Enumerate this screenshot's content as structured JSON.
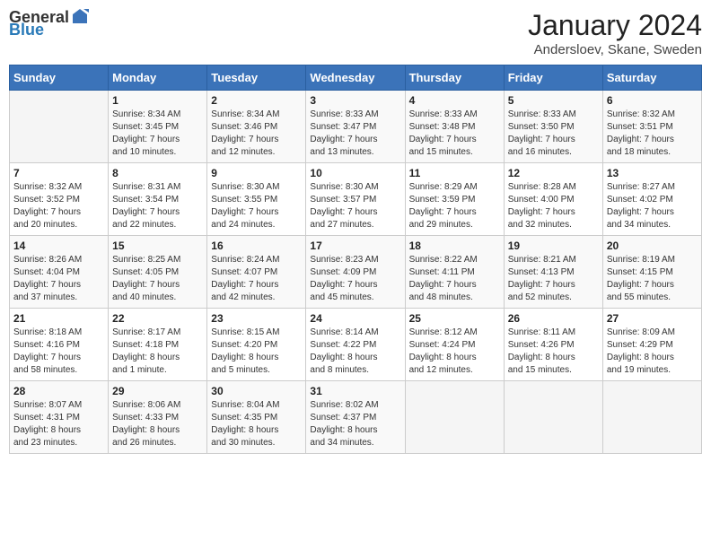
{
  "header": {
    "logo_general": "General",
    "logo_blue": "Blue",
    "month": "January 2024",
    "location": "Andersloev, Skane, Sweden"
  },
  "weekdays": [
    "Sunday",
    "Monday",
    "Tuesday",
    "Wednesday",
    "Thursday",
    "Friday",
    "Saturday"
  ],
  "weeks": [
    [
      {
        "day": "",
        "info": ""
      },
      {
        "day": "1",
        "info": "Sunrise: 8:34 AM\nSunset: 3:45 PM\nDaylight: 7 hours\nand 10 minutes."
      },
      {
        "day": "2",
        "info": "Sunrise: 8:34 AM\nSunset: 3:46 PM\nDaylight: 7 hours\nand 12 minutes."
      },
      {
        "day": "3",
        "info": "Sunrise: 8:33 AM\nSunset: 3:47 PM\nDaylight: 7 hours\nand 13 minutes."
      },
      {
        "day": "4",
        "info": "Sunrise: 8:33 AM\nSunset: 3:48 PM\nDaylight: 7 hours\nand 15 minutes."
      },
      {
        "day": "5",
        "info": "Sunrise: 8:33 AM\nSunset: 3:50 PM\nDaylight: 7 hours\nand 16 minutes."
      },
      {
        "day": "6",
        "info": "Sunrise: 8:32 AM\nSunset: 3:51 PM\nDaylight: 7 hours\nand 18 minutes."
      }
    ],
    [
      {
        "day": "7",
        "info": "Sunrise: 8:32 AM\nSunset: 3:52 PM\nDaylight: 7 hours\nand 20 minutes."
      },
      {
        "day": "8",
        "info": "Sunrise: 8:31 AM\nSunset: 3:54 PM\nDaylight: 7 hours\nand 22 minutes."
      },
      {
        "day": "9",
        "info": "Sunrise: 8:30 AM\nSunset: 3:55 PM\nDaylight: 7 hours\nand 24 minutes."
      },
      {
        "day": "10",
        "info": "Sunrise: 8:30 AM\nSunset: 3:57 PM\nDaylight: 7 hours\nand 27 minutes."
      },
      {
        "day": "11",
        "info": "Sunrise: 8:29 AM\nSunset: 3:59 PM\nDaylight: 7 hours\nand 29 minutes."
      },
      {
        "day": "12",
        "info": "Sunrise: 8:28 AM\nSunset: 4:00 PM\nDaylight: 7 hours\nand 32 minutes."
      },
      {
        "day": "13",
        "info": "Sunrise: 8:27 AM\nSunset: 4:02 PM\nDaylight: 7 hours\nand 34 minutes."
      }
    ],
    [
      {
        "day": "14",
        "info": "Sunrise: 8:26 AM\nSunset: 4:04 PM\nDaylight: 7 hours\nand 37 minutes."
      },
      {
        "day": "15",
        "info": "Sunrise: 8:25 AM\nSunset: 4:05 PM\nDaylight: 7 hours\nand 40 minutes."
      },
      {
        "day": "16",
        "info": "Sunrise: 8:24 AM\nSunset: 4:07 PM\nDaylight: 7 hours\nand 42 minutes."
      },
      {
        "day": "17",
        "info": "Sunrise: 8:23 AM\nSunset: 4:09 PM\nDaylight: 7 hours\nand 45 minutes."
      },
      {
        "day": "18",
        "info": "Sunrise: 8:22 AM\nSunset: 4:11 PM\nDaylight: 7 hours\nand 48 minutes."
      },
      {
        "day": "19",
        "info": "Sunrise: 8:21 AM\nSunset: 4:13 PM\nDaylight: 7 hours\nand 52 minutes."
      },
      {
        "day": "20",
        "info": "Sunrise: 8:19 AM\nSunset: 4:15 PM\nDaylight: 7 hours\nand 55 minutes."
      }
    ],
    [
      {
        "day": "21",
        "info": "Sunrise: 8:18 AM\nSunset: 4:16 PM\nDaylight: 7 hours\nand 58 minutes."
      },
      {
        "day": "22",
        "info": "Sunrise: 8:17 AM\nSunset: 4:18 PM\nDaylight: 8 hours\nand 1 minute."
      },
      {
        "day": "23",
        "info": "Sunrise: 8:15 AM\nSunset: 4:20 PM\nDaylight: 8 hours\nand 5 minutes."
      },
      {
        "day": "24",
        "info": "Sunrise: 8:14 AM\nSunset: 4:22 PM\nDaylight: 8 hours\nand 8 minutes."
      },
      {
        "day": "25",
        "info": "Sunrise: 8:12 AM\nSunset: 4:24 PM\nDaylight: 8 hours\nand 12 minutes."
      },
      {
        "day": "26",
        "info": "Sunrise: 8:11 AM\nSunset: 4:26 PM\nDaylight: 8 hours\nand 15 minutes."
      },
      {
        "day": "27",
        "info": "Sunrise: 8:09 AM\nSunset: 4:29 PM\nDaylight: 8 hours\nand 19 minutes."
      }
    ],
    [
      {
        "day": "28",
        "info": "Sunrise: 8:07 AM\nSunset: 4:31 PM\nDaylight: 8 hours\nand 23 minutes."
      },
      {
        "day": "29",
        "info": "Sunrise: 8:06 AM\nSunset: 4:33 PM\nDaylight: 8 hours\nand 26 minutes."
      },
      {
        "day": "30",
        "info": "Sunrise: 8:04 AM\nSunset: 4:35 PM\nDaylight: 8 hours\nand 30 minutes."
      },
      {
        "day": "31",
        "info": "Sunrise: 8:02 AM\nSunset: 4:37 PM\nDaylight: 8 hours\nand 34 minutes."
      },
      {
        "day": "",
        "info": ""
      },
      {
        "day": "",
        "info": ""
      },
      {
        "day": "",
        "info": ""
      }
    ]
  ]
}
